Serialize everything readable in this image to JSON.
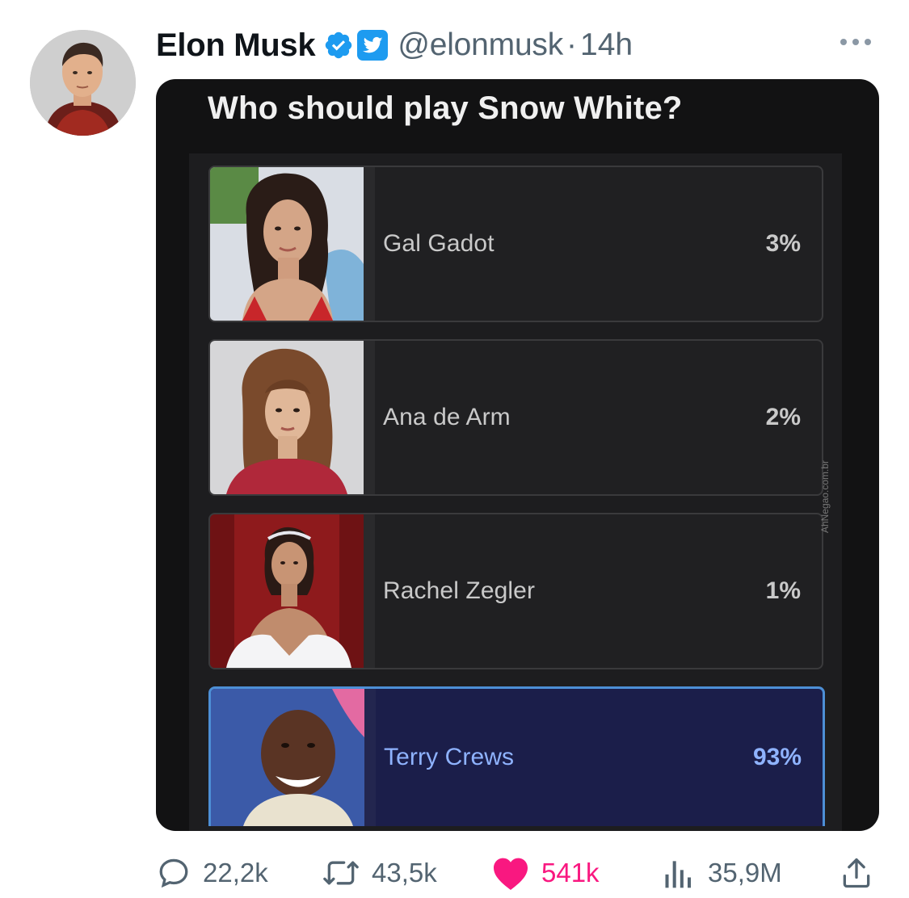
{
  "tweet": {
    "author": {
      "display_name": "Elon Musk",
      "handle": "@elonmusk",
      "verified_icon": "verified-badge-icon",
      "affiliate_icon": "twitter-bird-icon"
    },
    "separator": "·",
    "timestamp": "14h",
    "more_icon": "more-options-icon",
    "media": {
      "poll_title": "Who should play Snow White?",
      "options": [
        {
          "name": "Gal Gadot",
          "percent": "3%"
        },
        {
          "name": "Ana de Arm",
          "percent": "2%"
        },
        {
          "name": "Rachel Zegler",
          "percent": "1%"
        },
        {
          "name": "Terry Crews",
          "percent": "93%"
        }
      ],
      "watermark": "AhNegao.com.br"
    },
    "actions": {
      "replies": "22,2k",
      "retweets": "43,5k",
      "likes": "541k",
      "views": "35,9M"
    },
    "colors": {
      "accent": "#1d9bf0",
      "like": "#f91880",
      "muted": "#536471",
      "selected_option": "#1b1e4a"
    }
  }
}
